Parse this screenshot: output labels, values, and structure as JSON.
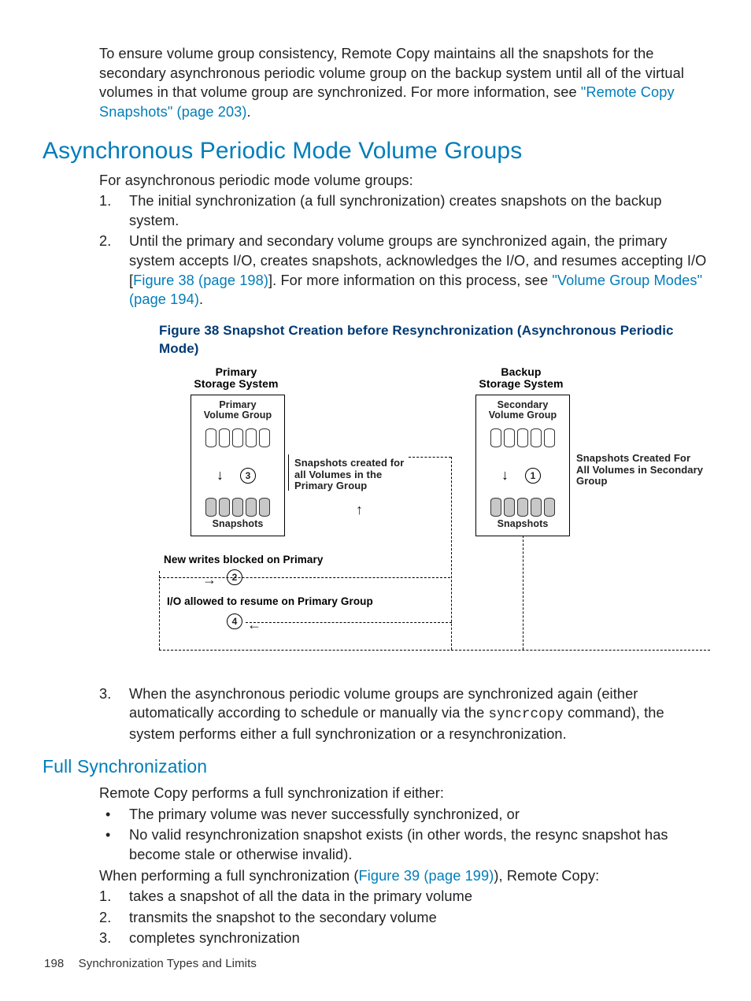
{
  "intro": {
    "p1a": "To ensure volume group consistency, Remote Copy maintains all the snapshots for the secondary asynchronous periodic volume group on the backup system until all of the virtual volumes in that volume group are synchronized. For more information, see ",
    "link1": "\"Remote Copy Snapshots\" (page 203)",
    "p1b": "."
  },
  "section1": {
    "heading": "Asynchronous Periodic Mode Volume Groups",
    "lead": "For asynchronous periodic mode volume groups:",
    "li1": "The initial synchronization (a full synchronization) creates snapshots on the backup system.",
    "li2a": "Until the primary and secondary volume groups are synchronized again, the primary system accepts I/O, creates snapshots, acknowledges the I/O, and resumes accepting I/O [",
    "li2_link1": "Figure 38 (page 198)",
    "li2b": "]. For more information on this process, see ",
    "li2_link2": "\"Volume Group Modes\" (page 194)",
    "li2c": ".",
    "fig_caption": "Figure 38 Snapshot Creation before Resynchronization (Asynchronous Periodic Mode)",
    "li3a": "When the asynchronous periodic volume groups are synchronized again (either automatically according to schedule or manually via the ",
    "li3_code": "syncrcopy",
    "li3b": " command), the system performs either a full synchronization or a resynchronization."
  },
  "figure": {
    "primary_sys": "Primary\nStorage System",
    "backup_sys": "Backup\nStorage System",
    "primary_group": "Primary\nVolume Group",
    "secondary_group": "Secondary\nVolume Group",
    "snapshots": "Snapshots",
    "note_primary": "Snapshots created for all Volumes in the Primary Group",
    "note_secondary": "Snapshots Created For All Volumes in Secondary Group",
    "new_writes": "New writes blocked on Primary",
    "io_resume": "I/O allowed to resume on Primary Group",
    "n1": "1",
    "n2": "2",
    "n3": "3",
    "n4": "4"
  },
  "section2": {
    "heading": "Full Synchronization",
    "p1": "Remote Copy performs a full synchronization if either:",
    "b1": "The primary volume was never successfully synchronized, or",
    "b2": "No valid resynchronization snapshot exists (in other words, the resync snapshot has become stale or otherwise invalid).",
    "p2a": "When performing a full synchronization (",
    "p2_link": "Figure 39 (page 199)",
    "p2b": "), Remote Copy:",
    "o1": "takes a snapshot of all the data in the primary volume",
    "o2": "transmits the snapshot to the secondary volume",
    "o3": "completes synchronization"
  },
  "footer": {
    "page_no": "198",
    "title": "Synchronization Types and Limits"
  }
}
